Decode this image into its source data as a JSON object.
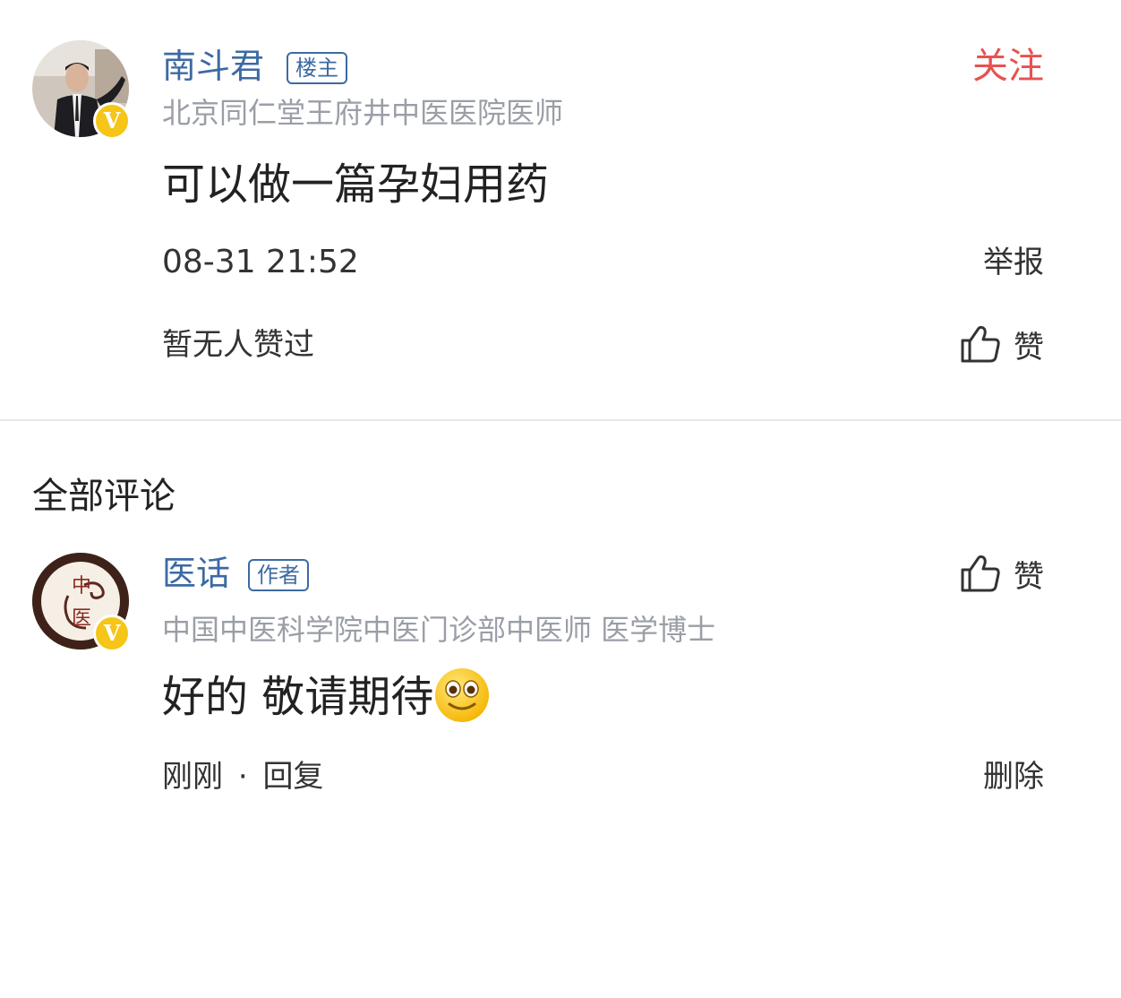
{
  "post": {
    "author": {
      "name": "南斗君",
      "tag": "楼主",
      "title": "北京同仁堂王府井中医医院医师",
      "verified_badge": "V"
    },
    "follow_label": "关注",
    "content": "可以做一篇孕妇用药",
    "timestamp": "08-31 21:52",
    "report_label": "举报",
    "likes_text": "暂无人赞过",
    "like_label": "赞"
  },
  "comments_section": {
    "title": "全部评论",
    "comments": [
      {
        "author": {
          "name": "医话",
          "tag": "作者",
          "title": "中国中医科学院中医门诊部中医师 医学博士",
          "verified_badge": "V",
          "avatar_text_top": "中",
          "avatar_text_bottom": "医"
        },
        "like_label": "赞",
        "content": "好的 敬请期待",
        "emoji": "smile-emoji",
        "time": "刚刚",
        "separator": "·",
        "reply_label": "回复",
        "delete_label": "删除"
      }
    ]
  },
  "colors": {
    "name_blue": "#3d6aa3",
    "follow_red": "#e8524f",
    "subtitle_gray": "#9a9ea6",
    "badge_yellow": "#f5c518"
  },
  "icons": {
    "thumbs_up": "thumbs-up-icon",
    "verified": "verified-badge-icon"
  }
}
